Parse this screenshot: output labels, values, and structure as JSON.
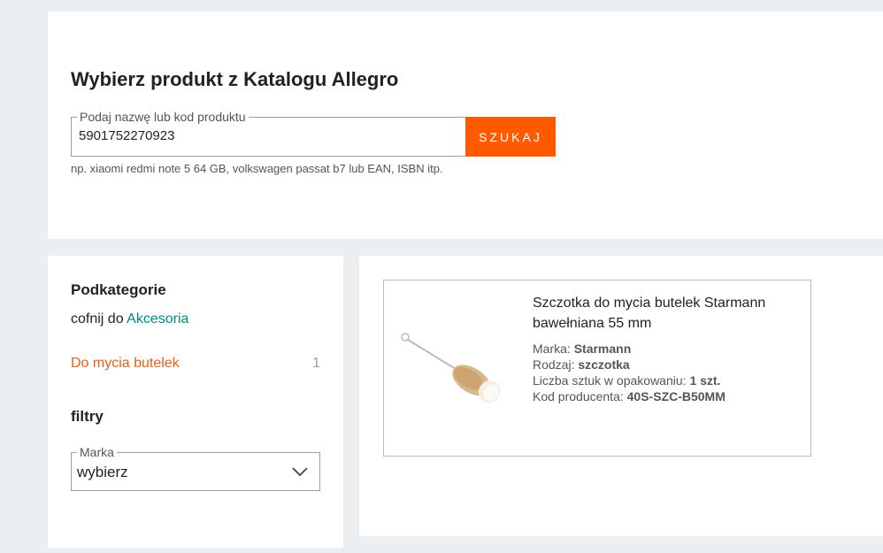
{
  "search": {
    "title": "Wybierz produkt z Katalogu Allegro",
    "field_label": "Podaj nazwę lub kod produktu",
    "value": "5901752270923",
    "button_label": "SZUKAJ",
    "hint": "np. xiaomi redmi note 5 64 GB, volkswagen passat b7 lub EAN, ISBN itp."
  },
  "sidebar": {
    "subcategories_heading": "Podkategorie",
    "back_prefix": "cofnij do",
    "back_link": "Akcesoria",
    "subcategories": [
      {
        "label": "Do mycia butelek",
        "count": "1"
      }
    ],
    "filters_heading": "filtry",
    "brand_filter": {
      "label": "Marka",
      "value": "wybierz",
      "icon": "chevron-down-icon"
    }
  },
  "results": {
    "products": [
      {
        "title": "Szczotka do mycia butelek Starmann bawełniana 55 mm",
        "params": [
          {
            "label": "Marka:",
            "value": "Starmann"
          },
          {
            "label": "Rodzaj:",
            "value": "szczotka"
          },
          {
            "label": "Liczba sztuk w opakowaniu:",
            "value": "1 szt."
          },
          {
            "label": "Kod producenta:",
            "value": "40S-SZC-B50MM"
          }
        ]
      }
    ]
  },
  "colors": {
    "accent": "#ff5a00",
    "link": "#00897b",
    "subcategory": "#e55f1b",
    "background": "#eceff1"
  }
}
